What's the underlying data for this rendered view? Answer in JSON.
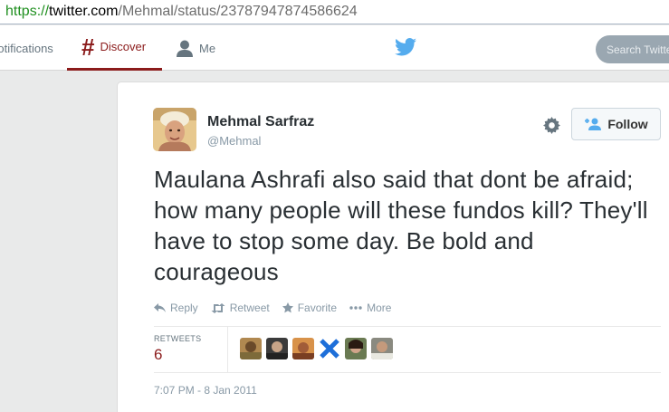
{
  "browser": {
    "url_protocol": "https://",
    "url_host": "twitter.com",
    "url_path": "/Mehmal/status/23787947874586624"
  },
  "nav": {
    "notifications_label": "Notifications",
    "discover_label": "Discover",
    "discover_icon": "#",
    "me_label": "Me",
    "search_placeholder": "Search Twitter",
    "accent_color": "#8b1b1b"
  },
  "tweet": {
    "author_name": "Mehmal Sarfraz",
    "author_handle": "@Mehmal",
    "follow_label": "Follow",
    "text": "Maulana Ashrafi also said that dont be afraid; how many people will these fundos kill? They'll have to stop some day. Be bold and courageous",
    "actions": {
      "reply": "Reply",
      "retweet": "Retweet",
      "favorite": "Favorite",
      "more": "More"
    },
    "retweets_label": "RETWEETS",
    "retweets_count": "6",
    "timestamp": "7:07 PM - 8 Jan 2011"
  },
  "icons": [
    "reply-icon",
    "retweet-icon",
    "star-icon",
    "more-dots-icon",
    "gear-icon",
    "add-user-icon",
    "twitter-bird-icon",
    "person-icon"
  ]
}
